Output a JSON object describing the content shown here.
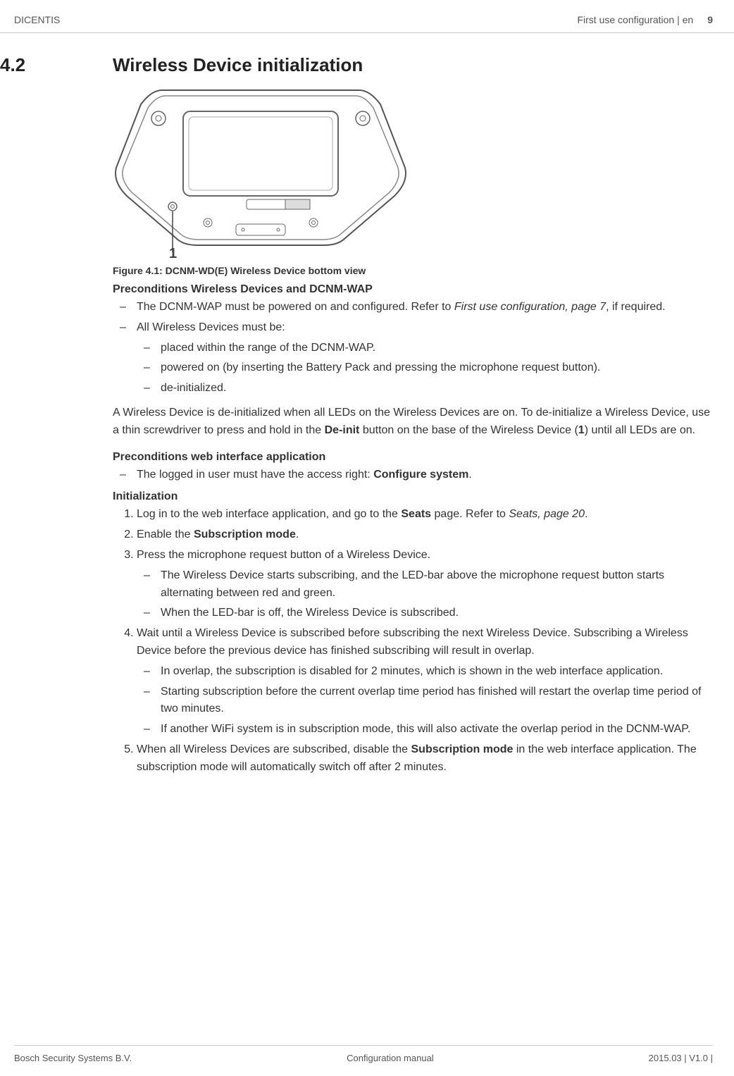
{
  "header": {
    "left": "DICENTIS",
    "right_text": "First use configuration | en",
    "page_number": "9"
  },
  "section": {
    "number": "4.2",
    "title": "Wireless Device initialization"
  },
  "figure": {
    "callout": "1",
    "caption": "Figure 4.1: DCNM-WD(E) Wireless Device bottom view"
  },
  "preconditions_devices": {
    "heading": "Preconditions Wireless Devices and DCNM-WAP",
    "item1_a": "The DCNM-WAP must be powered on and configured. Refer to ",
    "item1_b_italic": "First use configuration, page 7",
    "item1_c": ", if required.",
    "item2": "All Wireless Devices must be:",
    "sub1": "placed within the range of the DCNM-WAP.",
    "sub2": "powered on (by inserting the Battery Pack and pressing the microphone request button).",
    "sub3": "de-initialized.",
    "para_a": "A Wireless Device is de-initialized when all LEDs on the Wireless Devices are on. To de-initialize a Wireless Device, use a thin screwdriver to press and hold in the ",
    "para_b_bold": "De-init",
    "para_c": " button on the base of the Wireless Device (",
    "para_d_bold": "1",
    "para_e": ") until all LEDs are on."
  },
  "preconditions_web": {
    "heading": "Preconditions web interface application",
    "item1_a": "The logged in user must have the access right: ",
    "item1_b_bold": "Configure system",
    "item1_c": "."
  },
  "initialization": {
    "heading": "Initialization",
    "step1_a": "Log in to the web interface application, and go to the ",
    "step1_b_bold": "Seats",
    "step1_c": " page. Refer to ",
    "step1_d_italic": "Seats, page 20",
    "step1_e": ".",
    "step2_a": "Enable the ",
    "step2_b_bold": "Subscription mode",
    "step2_c": ".",
    "step3": "Press the microphone request button of a Wireless Device.",
    "step3_sub1": "The Wireless Device starts subscribing, and the LED-bar above the microphone request button starts alternating between red and green.",
    "step3_sub2": "When the LED-bar is off, the Wireless Device is subscribed.",
    "step4": "Wait until a Wireless Device is subscribed before subscribing the next Wireless Device. Subscribing a Wireless Device before the previous device has finished subscribing will result in overlap.",
    "step4_sub1": "In overlap, the subscription is disabled for 2 minutes, which is shown in the web interface application.",
    "step4_sub2": "Starting subscription before the current overlap time period has finished will restart the overlap time period of two minutes.",
    "step4_sub3": "If another WiFi system is in subscription mode, this will also activate the overlap period in the DCNM-WAP.",
    "step5_a": "When all Wireless Devices are subscribed, disable the ",
    "step5_b_bold": "Subscription mode",
    "step5_c": " in the web interface application. The subscription mode will automatically switch off after 2 minutes."
  },
  "footer": {
    "left": "Bosch Security Systems B.V.",
    "center": "Configuration manual",
    "right": "2015.03 | V1.0 |"
  }
}
